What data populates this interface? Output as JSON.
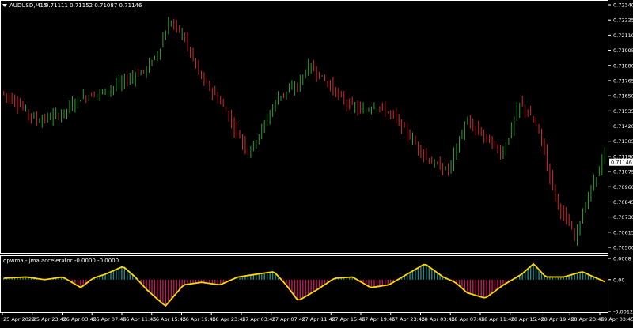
{
  "header": {
    "symbol": "AUDUSD,M15",
    "quote": "0.71111 0.71152 0.71087 0.71146",
    "indicator_title": "dpwma - jma accelerator -0.0000 -0.0000"
  },
  "chart_data": [
    {
      "type": "candlestick",
      "title": "AUDUSD,M15",
      "ylim": [
        0.705,
        0.7234
      ],
      "yticks": [
        0.7234,
        0.72225,
        0.7211,
        0.71995,
        0.7188,
        0.71765,
        0.7165,
        0.71535,
        0.7142,
        0.71305,
        0.7119,
        0.71075,
        0.7096,
        0.70845,
        0.7073,
        0.70615,
        0.705
      ],
      "ytick_labels": [
        "0.72340",
        "0.72225",
        "0.72110",
        "0.71995",
        "0.71880",
        "0.71765",
        "0.71650",
        "0.71535",
        "0.71420",
        "0.71305",
        "0.71190",
        "0.71075",
        "0.70960",
        "0.70845",
        "0.70730",
        "0.70615",
        "0.70500"
      ],
      "last_price_label": "0.71146",
      "last_price": 0.71146,
      "colors": {
        "up": "#2ca02c",
        "down": "#d62728",
        "background": "#000000",
        "axis": "#ffffff"
      },
      "path_t": [
        0,
        3,
        6,
        10,
        13,
        17,
        20,
        24,
        26,
        28,
        30,
        33,
        36,
        37,
        39,
        41,
        43,
        46,
        49,
        51,
        54,
        57,
        60,
        62,
        65,
        68,
        71,
        74,
        77,
        80,
        83,
        86,
        89,
        92,
        95,
        98,
        100
      ],
      "path_price": [
        0.7168,
        0.7158,
        0.7146,
        0.7151,
        0.7163,
        0.7168,
        0.7175,
        0.7185,
        0.7198,
        0.7222,
        0.7212,
        0.718,
        0.7162,
        0.7155,
        0.7138,
        0.7122,
        0.7138,
        0.7165,
        0.7172,
        0.7188,
        0.7175,
        0.716,
        0.7153,
        0.7158,
        0.715,
        0.7132,
        0.7115,
        0.7108,
        0.7145,
        0.7135,
        0.712,
        0.716,
        0.714,
        0.7085,
        0.7058,
        0.7098,
        0.712
      ],
      "candle_count": 220
    },
    {
      "type": "histogram+line",
      "title": "dpwma - jma accelerator -0.0000 -0.0000",
      "ylim": [
        -0.0012,
        0.0008
      ],
      "yticks": [
        0.0008,
        0.0,
        -0.0012
      ],
      "ytick_labels": [
        "0.0008",
        "0.00",
        "-0.0012"
      ],
      "colors": {
        "positive": "#1f8a8a",
        "negative": "#c0185a",
        "line": "#ffd700"
      },
      "path_t": [
        0,
        4,
        7,
        10,
        13,
        15,
        17,
        20,
        22,
        24,
        27,
        30,
        33,
        36,
        39,
        42,
        45,
        47,
        49,
        52,
        55,
        58,
        61,
        64,
        67,
        70,
        73,
        75,
        77,
        80,
        83,
        86,
        88,
        90,
        93,
        96,
        98,
        100
      ],
      "path_value": [
        5e-05,
        0.0001,
        0.0,
        0.0001,
        -0.0003,
        5e-05,
        0.0002,
        0.0005,
        0.0001,
        -0.0004,
        -0.001,
        -0.0002,
        -0.0001,
        -0.0002,
        0.0001,
        0.0002,
        0.0003,
        -0.0002,
        -0.0008,
        -0.0004,
        5e-05,
        0.0001,
        -0.0003,
        -0.0002,
        0.0002,
        0.0006,
        0.0001,
        -0.0001,
        -0.0005,
        -0.0007,
        -0.0002,
        0.0002,
        0.0006,
        0.0001,
        0.0001,
        0.0003,
        0.0001,
        -0.0001
      ],
      "bar_count": 220
    }
  ],
  "x_axis": {
    "labels": [
      "25 Apr 2022",
      "25 Apr 23:45",
      "26 Apr 03:45",
      "26 Apr 07:45",
      "26 Apr 11:45",
      "26 Apr 15:45",
      "26 Apr 19:45",
      "26 Apr 23:45",
      "27 Apr 03:45",
      "27 Apr 07:45",
      "27 Apr 11:45",
      "27 Apr 15:45",
      "27 Apr 19:45",
      "27 Apr 23:45",
      "28 Apr 03:45",
      "28 Apr 07:45",
      "28 Apr 11:45",
      "28 Apr 15:45",
      "28 Apr 19:45",
      "28 Apr 23:45",
      "29 Apr 03:45"
    ]
  }
}
